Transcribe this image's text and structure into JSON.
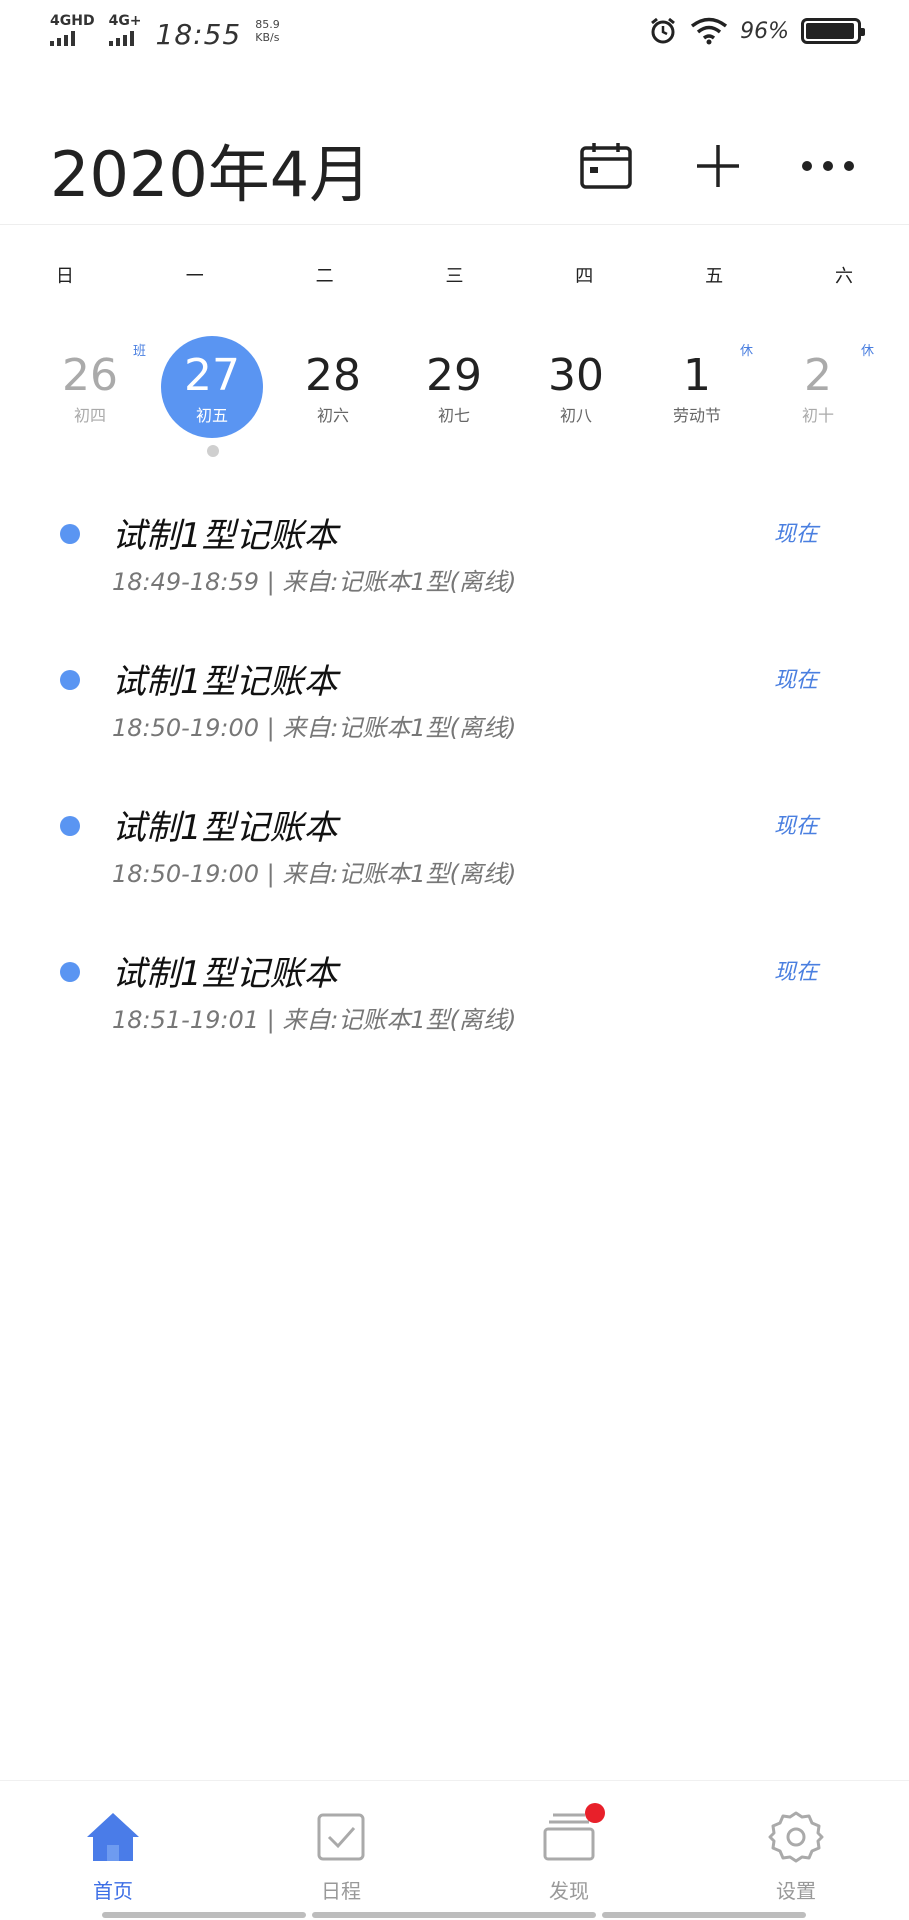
{
  "status_bar": {
    "network1": "4GHD",
    "network2": "4G+",
    "time": "18:55",
    "speed_value": "85.9",
    "speed_unit": "KB/s",
    "battery": "96%",
    "battery_level": 0.96
  },
  "header": {
    "title": "2020年4月",
    "icons": [
      "calendar-icon",
      "plus-icon",
      "more-icon"
    ]
  },
  "weekdays": [
    "日",
    "一",
    "二",
    "三",
    "四",
    "五",
    "六"
  ],
  "days": [
    {
      "num": "26",
      "lunar": "初四",
      "tag": "班",
      "muted": true
    },
    {
      "num": "27",
      "lunar": "初五",
      "tag": "",
      "selected": true
    },
    {
      "num": "28",
      "lunar": "初六",
      "tag": ""
    },
    {
      "num": "29",
      "lunar": "初七",
      "tag": ""
    },
    {
      "num": "30",
      "lunar": "初八",
      "tag": ""
    },
    {
      "num": "1",
      "lunar": "劳动节",
      "tag": "休"
    },
    {
      "num": "2",
      "lunar": "初十",
      "tag": "休",
      "muted": true
    }
  ],
  "events": [
    {
      "title": "试制1型记账本",
      "meta": "18:49-18:59 | 来自:记账本1型(离线)",
      "status": "现在"
    },
    {
      "title": "试制1型记账本",
      "meta": "18:50-19:00 | 来自:记账本1型(离线)",
      "status": "现在"
    },
    {
      "title": "试制1型记账本",
      "meta": "18:50-19:00 | 来自:记账本1型(离线)",
      "status": "现在"
    },
    {
      "title": "试制1型记账本",
      "meta": "18:51-19:01 | 来自:记账本1型(离线)",
      "status": "现在"
    }
  ],
  "nav": [
    {
      "label": "首页",
      "icon": "home-icon",
      "active": true
    },
    {
      "label": "日程",
      "icon": "checkbox-icon"
    },
    {
      "label": "发现",
      "icon": "cards-icon",
      "badge": true
    },
    {
      "label": "设置",
      "icon": "settings-gear-icon"
    }
  ],
  "colors": {
    "accent": "#5a95f2",
    "nav_active": "#3c6ee6",
    "badge": "#e8202a"
  }
}
